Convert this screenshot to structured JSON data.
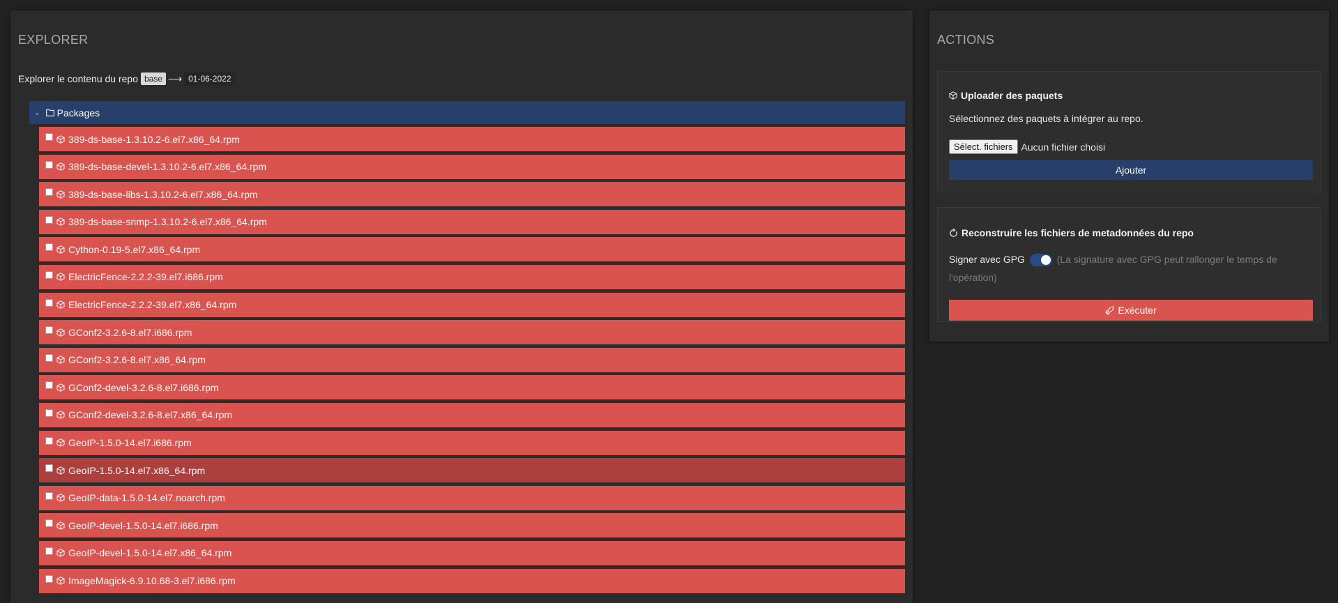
{
  "explorer": {
    "title": "EXPLORER",
    "repo_intro": "Explorer le contenu du repo",
    "repo_name": "base",
    "repo_arrow": "⟶",
    "repo_date": "01-06-2022",
    "folder_toggle": "-",
    "folder_name": "Packages",
    "packages": [
      "389-ds-base-1.3.10.2-6.el7.x86_64.rpm",
      "389-ds-base-devel-1.3.10.2-6.el7.x86_64.rpm",
      "389-ds-base-libs-1.3.10.2-6.el7.x86_64.rpm",
      "389-ds-base-snmp-1.3.10.2-6.el7.x86_64.rpm",
      "Cython-0.19-5.el7.x86_64.rpm",
      "ElectricFence-2.2.2-39.el7.i686.rpm",
      "ElectricFence-2.2.2-39.el7.x86_64.rpm",
      "GConf2-3.2.6-8.el7.i686.rpm",
      "GConf2-3.2.6-8.el7.x86_64.rpm",
      "GConf2-devel-3.2.6-8.el7.i686.rpm",
      "GConf2-devel-3.2.6-8.el7.x86_64.rpm",
      "GeoIP-1.5.0-14.el7.i686.rpm",
      "GeoIP-1.5.0-14.el7.x86_64.rpm",
      "GeoIP-data-1.5.0-14.el7.noarch.rpm",
      "GeoIP-devel-1.5.0-14.el7.i686.rpm",
      "GeoIP-devel-1.5.0-14.el7.x86_64.rpm",
      "ImageMagick-6.9.10.68-3.el7.i686.rpm"
    ],
    "hovered_index": 12
  },
  "actions": {
    "title": "ACTIONS",
    "upload": {
      "title": "Uploader des paquets",
      "description": "Sélectionnez des paquets à intégrer au repo.",
      "file_button": "Sélect. fichiers",
      "no_file": "Aucun fichier choisi",
      "add_button": "Ajouter"
    },
    "rebuild": {
      "title": "Reconstruire les fichiers de metadonnées du repo",
      "gpg_label": "Signer avec GPG",
      "gpg_enabled": true,
      "gpg_note": "(La signature avec GPG peut rallonger le temps de l'opération)",
      "execute_button": "Exécuter"
    }
  },
  "colors": {
    "background": "#222222",
    "panel": "#2b2b2b",
    "primary": "#27406b",
    "danger": "#d9534f",
    "danger_hover": "#ad3f3c"
  },
  "icons": {
    "folder": "folder-icon",
    "package": "package-icon",
    "refresh": "refresh-icon",
    "execute": "rocket-icon"
  }
}
